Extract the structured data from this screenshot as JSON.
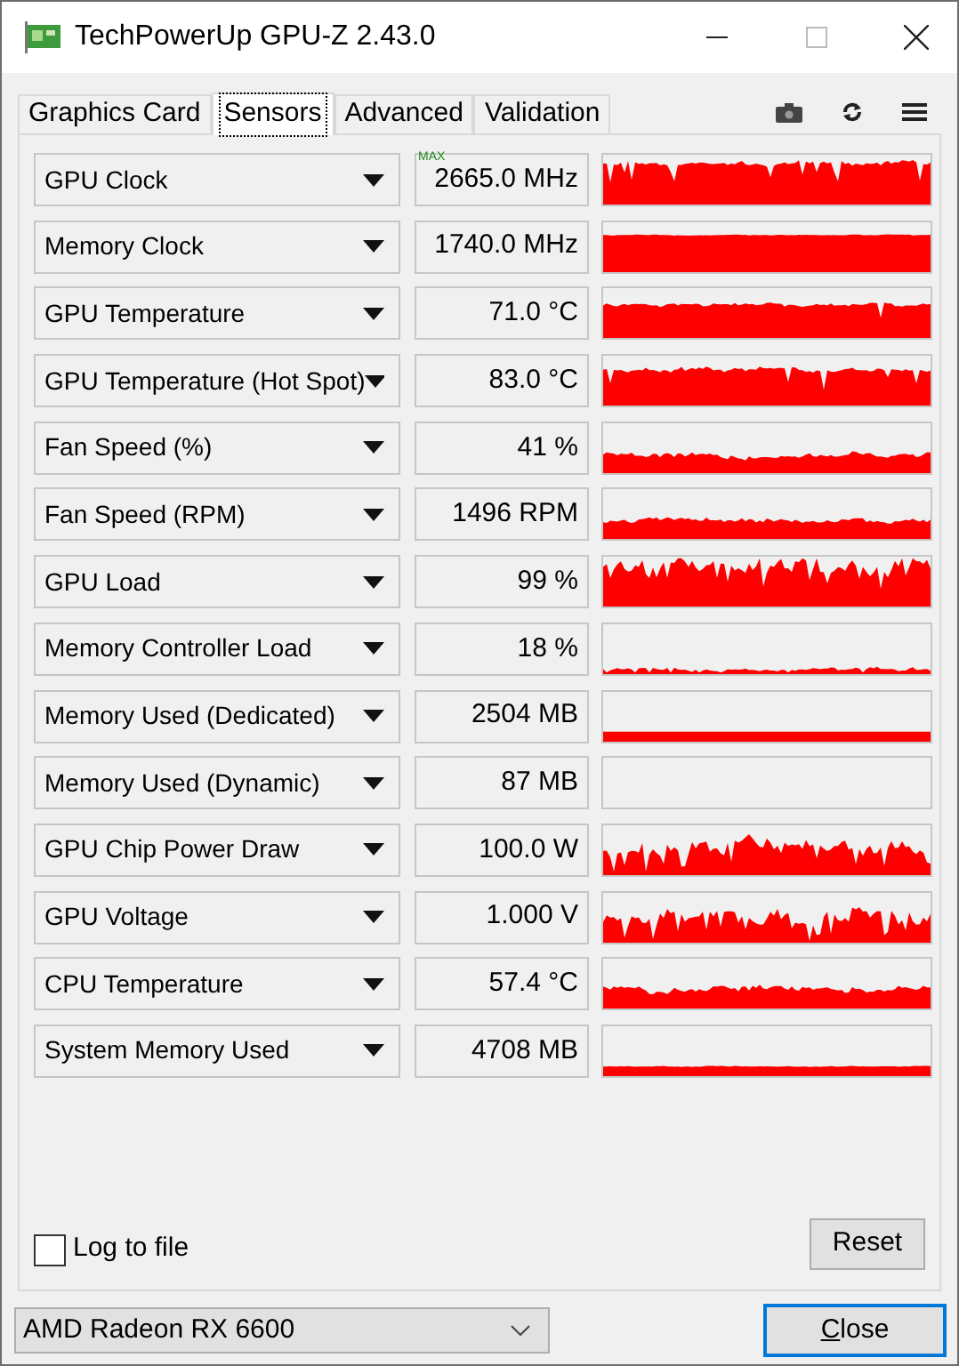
{
  "window": {
    "title": "TechPowerUp GPU-Z 2.43.0"
  },
  "tabs": [
    {
      "label": "Graphics Card",
      "selected": false
    },
    {
      "label": "Sensors",
      "selected": true
    },
    {
      "label": "Advanced",
      "selected": false
    },
    {
      "label": "Validation",
      "selected": false
    }
  ],
  "sensors": [
    {
      "name": "GPU Clock",
      "value": "2665.0 MHz",
      "badge": "MAX"
    },
    {
      "name": "Memory Clock",
      "value": "1740.0 MHz"
    },
    {
      "name": "GPU Temperature",
      "value": "71.0 °C"
    },
    {
      "name": "GPU Temperature (Hot Spot)",
      "value": "83.0 °C"
    },
    {
      "name": "Fan Speed (%)",
      "value": "41 %"
    },
    {
      "name": "Fan Speed (RPM)",
      "value": "1496 RPM"
    },
    {
      "name": "GPU Load",
      "value": "99 %"
    },
    {
      "name": "Memory Controller Load",
      "value": "18 %"
    },
    {
      "name": "Memory Used (Dedicated)",
      "value": "2504 MB"
    },
    {
      "name": "Memory Used (Dynamic)",
      "value": "87 MB"
    },
    {
      "name": "GPU Chip Power Draw",
      "value": "100.0 W"
    },
    {
      "name": "GPU Voltage",
      "value": "1.000 V"
    },
    {
      "name": "CPU Temperature",
      "value": "57.4 °C"
    },
    {
      "name": "System Memory Used",
      "value": "4708 MB"
    }
  ],
  "log_to_file": {
    "label": "Log to file",
    "checked": false
  },
  "reset_button": "Reset",
  "device_select": {
    "value": "AMD Radeon RX 6600"
  },
  "close_button": "Close"
}
